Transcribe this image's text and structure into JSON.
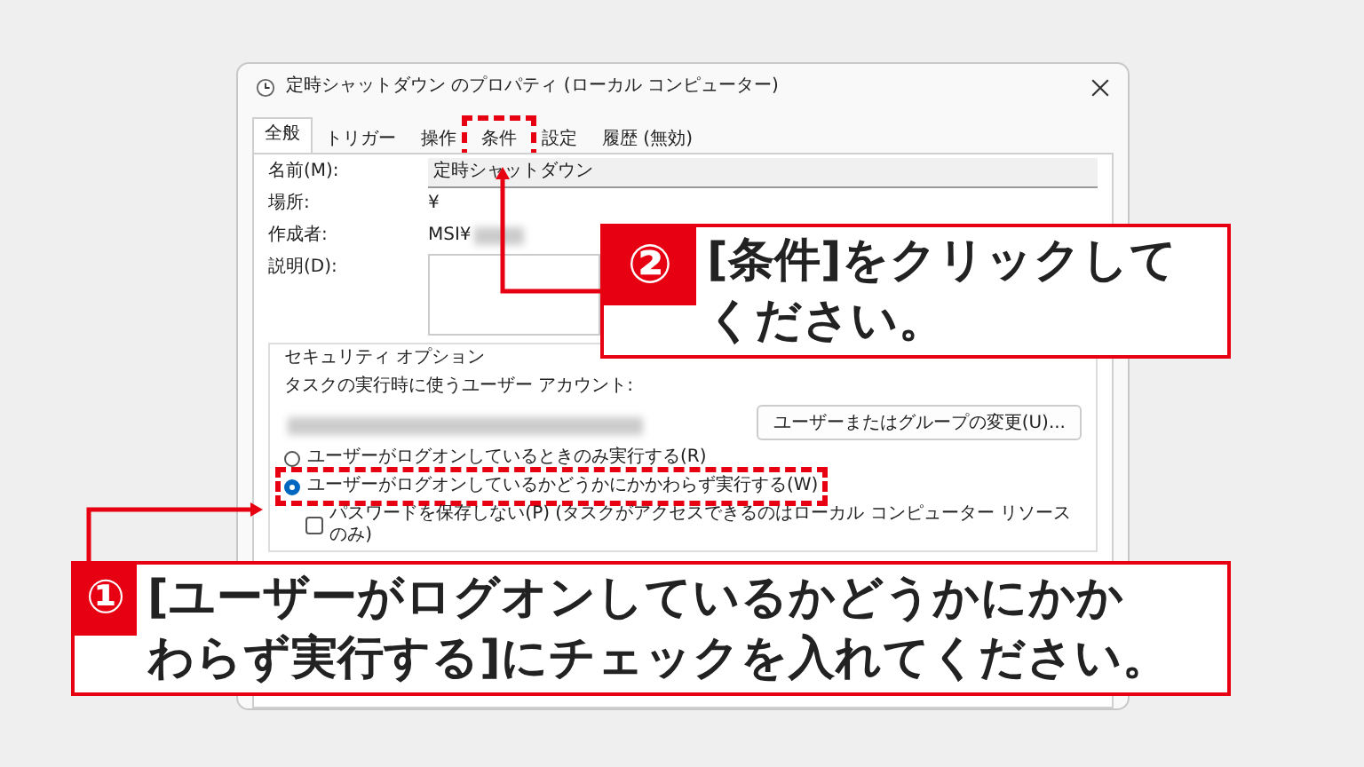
{
  "dialog": {
    "title": "定時シャットダウン のプロパティ (ローカル コンピューター)",
    "tabs": [
      {
        "label": "全般",
        "selected": true,
        "highlighted": false
      },
      {
        "label": "トリガー",
        "selected": false,
        "highlighted": false
      },
      {
        "label": "操作",
        "selected": false,
        "highlighted": false
      },
      {
        "label": "条件",
        "selected": false,
        "highlighted": true
      },
      {
        "label": "設定",
        "selected": false,
        "highlighted": false
      },
      {
        "label": "履歴 (無効)",
        "selected": false,
        "highlighted": false
      }
    ],
    "fields": [
      {
        "label": "名前(M):",
        "value": "定時シャットダウン",
        "kind": "input"
      },
      {
        "label": "場所:",
        "value": "¥",
        "kind": "text"
      },
      {
        "label": "作成者:",
        "value": "MSI¥",
        "kind": "redacted"
      },
      {
        "label": "説明(D):",
        "kind": "textarea"
      }
    ],
    "security": {
      "title": "セキュリティ オプション",
      "account_label": "タスクの実行時に使うユーザー アカウント:",
      "change_button": "ユーザーまたはグループの変更(U)...",
      "options": [
        {
          "label": "ユーザーがログオンしているときのみ実行する(R)",
          "selected": false,
          "highlighted": false
        },
        {
          "label": "ユーザーがログオンしているかどうかにかかわらず実行する(W)",
          "selected": true,
          "highlighted": true
        }
      ],
      "no_password": {
        "label": "パスワードを保存しない(P) (タスクがアクセスできるのはローカル コンピューター リソースのみ)",
        "checked": false
      }
    }
  },
  "callouts": [
    {
      "number": "②",
      "lines": [
        "[条件]をクリックして",
        "ください。"
      ]
    },
    {
      "number": "①",
      "lines": [
        "[ユーザーがログオンしているかどうかにかか",
        "わらず実行する]にチェックを入れてください。"
      ]
    }
  ]
}
